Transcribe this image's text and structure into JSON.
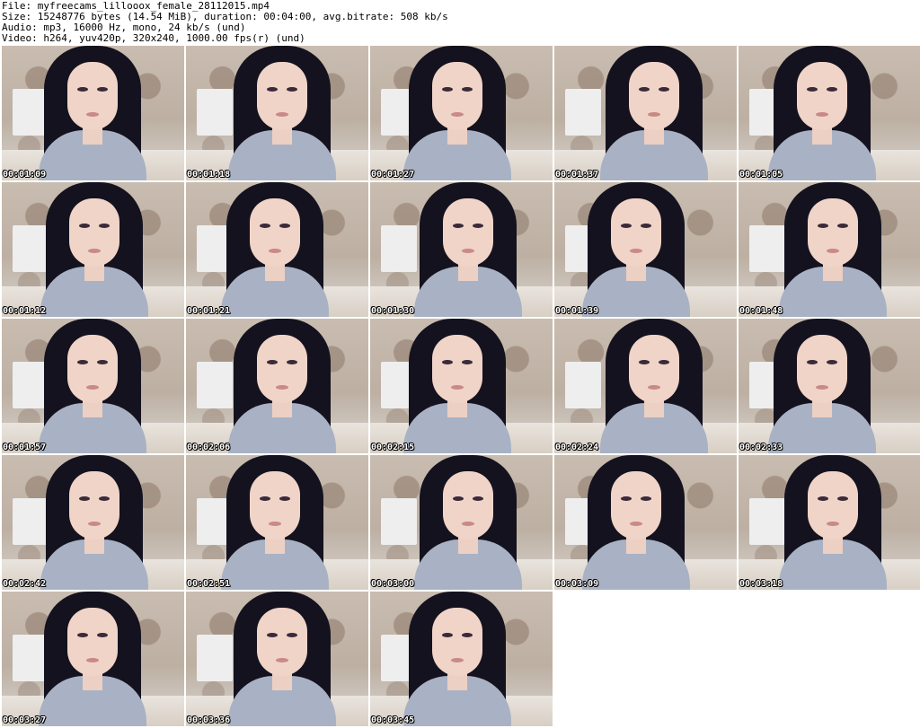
{
  "header": {
    "file_line": "File: myfreecams_lillooox_female_28112015.mp4",
    "size_line": "Size: 15248776 bytes (14.54 MiB), duration: 00:04:00, avg.bitrate: 508 kb/s",
    "audio_line": "Audio: mp3, 16000 Hz, mono, 24 kb/s (und)",
    "video_line": "Video: h264, yuv420p, 320x240, 1000.00 fps(r) (und)"
  },
  "thumbnails": [
    {
      "timestamp": "00:01:09"
    },
    {
      "timestamp": "00:01:18"
    },
    {
      "timestamp": "00:01:27"
    },
    {
      "timestamp": "00:01:37"
    },
    {
      "timestamp": "00:01:05"
    },
    {
      "timestamp": "00:01:12"
    },
    {
      "timestamp": "00:01:21"
    },
    {
      "timestamp": "00:01:30"
    },
    {
      "timestamp": "00:01:39"
    },
    {
      "timestamp": "00:01:48"
    },
    {
      "timestamp": "00:01:57"
    },
    {
      "timestamp": "00:02:06"
    },
    {
      "timestamp": "00:02:15"
    },
    {
      "timestamp": "00:02:24"
    },
    {
      "timestamp": "00:02:33"
    },
    {
      "timestamp": "00:02:42"
    },
    {
      "timestamp": "00:02:51"
    },
    {
      "timestamp": "00:03:00"
    },
    {
      "timestamp": "00:03:09"
    },
    {
      "timestamp": "00:03:18"
    },
    {
      "timestamp": "00:03:27"
    },
    {
      "timestamp": "00:03:36"
    },
    {
      "timestamp": "00:03:45"
    }
  ]
}
